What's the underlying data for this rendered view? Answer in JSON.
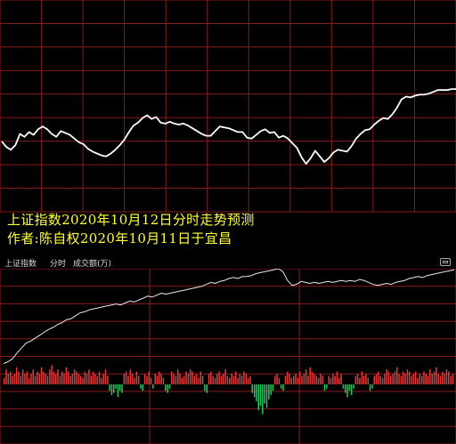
{
  "caption": {
    "line1": "上证指数2020年10月12日分时走势预测",
    "line2": "作者:陈自权2020年10月11日于宜昌"
  },
  "panel": {
    "title": "上证指数",
    "mode": "分时",
    "metric": "成交额(万)"
  },
  "colors": {
    "background": "#000000",
    "grid": "#8b1a1a",
    "forecast_line": "#ffffff",
    "index_line": "#e8e8e8",
    "caption": "#ffff33",
    "volume_up": "#e03a3a",
    "volume_down": "#22c55e"
  },
  "chart_data": [
    {
      "type": "line",
      "title": "",
      "grid": true,
      "x_range": [
        0,
        100
      ],
      "y_range": [
        0,
        100
      ],
      "series": [
        {
          "values": [
            [
              0,
              42
            ],
            [
              1,
              36
            ],
            [
              2,
              33
            ],
            [
              3,
              38
            ],
            [
              4,
              50
            ],
            [
              5,
              47
            ],
            [
              6,
              52
            ],
            [
              7,
              49
            ],
            [
              8,
              55
            ],
            [
              9,
              58
            ],
            [
              10,
              55
            ],
            [
              11,
              50
            ],
            [
              12,
              47
            ],
            [
              13,
              53
            ],
            [
              14,
              51
            ],
            [
              15,
              49
            ],
            [
              16,
              45
            ],
            [
              17,
              41
            ],
            [
              18,
              39
            ],
            [
              19,
              34
            ],
            [
              20,
              31
            ],
            [
              21,
              29
            ],
            [
              22,
              27
            ],
            [
              23,
              26
            ],
            [
              24,
              29
            ],
            [
              25,
              33
            ],
            [
              26,
              38
            ],
            [
              27,
              44
            ],
            [
              28,
              52
            ],
            [
              29,
              59
            ],
            [
              30,
              62
            ],
            [
              31,
              67
            ],
            [
              32,
              70
            ],
            [
              33,
              66
            ],
            [
              34,
              68
            ],
            [
              35,
              62
            ],
            [
              36,
              61
            ],
            [
              37,
              63
            ],
            [
              38,
              61
            ],
            [
              39,
              60
            ],
            [
              40,
              61
            ],
            [
              41,
              59
            ],
            [
              42,
              56
            ],
            [
              43,
              53
            ],
            [
              44,
              50
            ],
            [
              45,
              48
            ],
            [
              46,
              48
            ],
            [
              47,
              53
            ],
            [
              48,
              58
            ],
            [
              49,
              57
            ],
            [
              50,
              56
            ],
            [
              51,
              54
            ],
            [
              52,
              52
            ],
            [
              53,
              52
            ],
            [
              54,
              46
            ],
            [
              55,
              45
            ],
            [
              56,
              49
            ],
            [
              57,
              53
            ],
            [
              58,
              55
            ],
            [
              59,
              51
            ],
            [
              60,
              52
            ],
            [
              61,
              46
            ],
            [
              62,
              48
            ],
            [
              63,
              45
            ],
            [
              64,
              40
            ],
            [
              65,
              35
            ],
            [
              66,
              25
            ],
            [
              67,
              18
            ],
            [
              68,
              24
            ],
            [
              69,
              32
            ],
            [
              70,
              26
            ],
            [
              71,
              20
            ],
            [
              72,
              24
            ],
            [
              73,
              30
            ],
            [
              74,
              33
            ],
            [
              75,
              32
            ],
            [
              76,
              31
            ],
            [
              77,
              37
            ],
            [
              78,
              45
            ],
            [
              79,
              50
            ],
            [
              80,
              54
            ],
            [
              81,
              55
            ],
            [
              82,
              60
            ],
            [
              83,
              64
            ],
            [
              84,
              67
            ],
            [
              85,
              66
            ],
            [
              86,
              71
            ],
            [
              87,
              78
            ],
            [
              88,
              87
            ],
            [
              89,
              90
            ],
            [
              90,
              89
            ],
            [
              91,
              91
            ],
            [
              92,
              92
            ],
            [
              93,
              92
            ],
            [
              94,
              93
            ],
            [
              95,
              95
            ],
            [
              96,
              97
            ],
            [
              97,
              97
            ],
            [
              98,
              97
            ],
            [
              99,
              98
            ],
            [
              100,
              98
            ]
          ]
        }
      ]
    },
    {
      "type": "line",
      "title": "上证指数",
      "subtitle": "分时 成交额(万)",
      "grid": true,
      "x_range": [
        0,
        100
      ],
      "y_range": [
        0,
        100
      ],
      "series": [
        {
          "values": [
            [
              0,
              3
            ],
            [
              1,
              5
            ],
            [
              2,
              8
            ],
            [
              3,
              14
            ],
            [
              4,
              19
            ],
            [
              5,
              24
            ],
            [
              6,
              26
            ],
            [
              7,
              29
            ],
            [
              8,
              32
            ],
            [
              9,
              35
            ],
            [
              10,
              38
            ],
            [
              11,
              40
            ],
            [
              12,
              43
            ],
            [
              13,
              45
            ],
            [
              14,
              48
            ],
            [
              15,
              49
            ],
            [
              16,
              52
            ],
            [
              17,
              55
            ],
            [
              18,
              56
            ],
            [
              19,
              58
            ],
            [
              20,
              59
            ],
            [
              21,
              60
            ],
            [
              22,
              61
            ],
            [
              23,
              62
            ],
            [
              24,
              63
            ],
            [
              25,
              64
            ],
            [
              26,
              63
            ],
            [
              27,
              65
            ],
            [
              28,
              67
            ],
            [
              29,
              66
            ],
            [
              30,
              68
            ],
            [
              31,
              70
            ],
            [
              32,
              72
            ],
            [
              33,
              71
            ],
            [
              34,
              73
            ],
            [
              35,
              75
            ],
            [
              36,
              74
            ],
            [
              37,
              75
            ],
            [
              38,
              76
            ],
            [
              39,
              77
            ],
            [
              40,
              78
            ],
            [
              41,
              79
            ],
            [
              42,
              80
            ],
            [
              43,
              81
            ],
            [
              44,
              82
            ],
            [
              45,
              84
            ],
            [
              46,
              86
            ],
            [
              47,
              85
            ],
            [
              48,
              87
            ],
            [
              49,
              88
            ],
            [
              50,
              90
            ],
            [
              51,
              91
            ],
            [
              52,
              90
            ],
            [
              53,
              92
            ],
            [
              54,
              92
            ],
            [
              55,
              93
            ],
            [
              56,
              95
            ],
            [
              57,
              96
            ],
            [
              58,
              97
            ],
            [
              59,
              98
            ],
            [
              60,
              99
            ],
            [
              61,
              100
            ],
            [
              62,
              97
            ],
            [
              63,
              88
            ],
            [
              64,
              83
            ],
            [
              65,
              84
            ],
            [
              66,
              87
            ],
            [
              67,
              86
            ],
            [
              68,
              85
            ],
            [
              69,
              86
            ],
            [
              70,
              85
            ],
            [
              71,
              86
            ],
            [
              72,
              87
            ],
            [
              73,
              86
            ],
            [
              74,
              87
            ],
            [
              75,
              88
            ],
            [
              76,
              87
            ],
            [
              77,
              88
            ],
            [
              78,
              87
            ],
            [
              79,
              89
            ],
            [
              80,
              88
            ],
            [
              81,
              86
            ],
            [
              82,
              84
            ],
            [
              83,
              83
            ],
            [
              84,
              84
            ],
            [
              85,
              85
            ],
            [
              86,
              84
            ],
            [
              87,
              86
            ],
            [
              88,
              87
            ],
            [
              89,
              88
            ],
            [
              90,
              90
            ],
            [
              91,
              91
            ],
            [
              92,
              92
            ],
            [
              93,
              91
            ],
            [
              94,
              93
            ],
            [
              95,
              94
            ],
            [
              96,
              95
            ],
            [
              97,
              96
            ],
            [
              98,
              97
            ],
            [
              99,
              98
            ],
            [
              100,
              99
            ]
          ]
        },
        {
          "values": [
            3,
            7,
            5,
            6,
            4,
            5,
            8,
            6,
            4,
            7,
            5,
            6,
            3,
            5,
            7,
            4,
            6,
            5,
            8,
            6,
            5,
            4,
            7,
            9,
            6,
            5,
            7,
            4,
            6,
            5,
            8,
            6,
            4,
            5,
            7,
            6,
            5,
            4,
            3,
            6,
            5,
            7,
            4,
            6,
            5,
            4,
            6,
            3,
            5,
            7,
            4,
            -3,
            -5,
            -4,
            -2,
            -6,
            -3,
            -4,
            5,
            6,
            4,
            7,
            5,
            3,
            6,
            4,
            -2,
            -3,
            5,
            4,
            6,
            3,
            -2,
            5,
            4,
            6,
            5,
            3,
            -3,
            -4,
            -2,
            6,
            5,
            4,
            7,
            5,
            3,
            4,
            6,
            5,
            7,
            6,
            4,
            5,
            3,
            6,
            4,
            -3,
            -4,
            5,
            6,
            4,
            3,
            5,
            6,
            4,
            5,
            7,
            4,
            3,
            5,
            4,
            6,
            3,
            5,
            4,
            6,
            5,
            3,
            4,
            -4,
            -6,
            -8,
            -12,
            -10,
            -14,
            -9,
            -11,
            -7,
            -5,
            -3,
            4,
            5,
            3,
            -2,
            -3,
            4,
            6,
            5,
            3,
            4,
            5,
            3,
            6,
            4,
            5,
            7,
            4,
            8,
            6,
            5,
            4,
            3,
            5,
            4,
            -3,
            -2,
            4,
            3,
            5,
            4,
            6,
            3,
            5,
            -2,
            -4,
            -6,
            -3,
            -5,
            -2,
            4,
            5,
            3,
            6,
            4,
            5,
            3,
            -3,
            -2,
            4,
            5,
            6,
            4,
            3,
            5,
            7,
            6,
            4,
            5,
            6,
            8,
            5,
            4,
            6,
            5,
            7,
            6,
            4,
            5,
            6,
            3,
            5,
            4,
            6,
            5,
            4,
            7,
            5,
            6,
            8,
            5,
            4,
            6,
            5,
            7,
            6,
            4,
            5
          ]
        }
      ]
    }
  ]
}
